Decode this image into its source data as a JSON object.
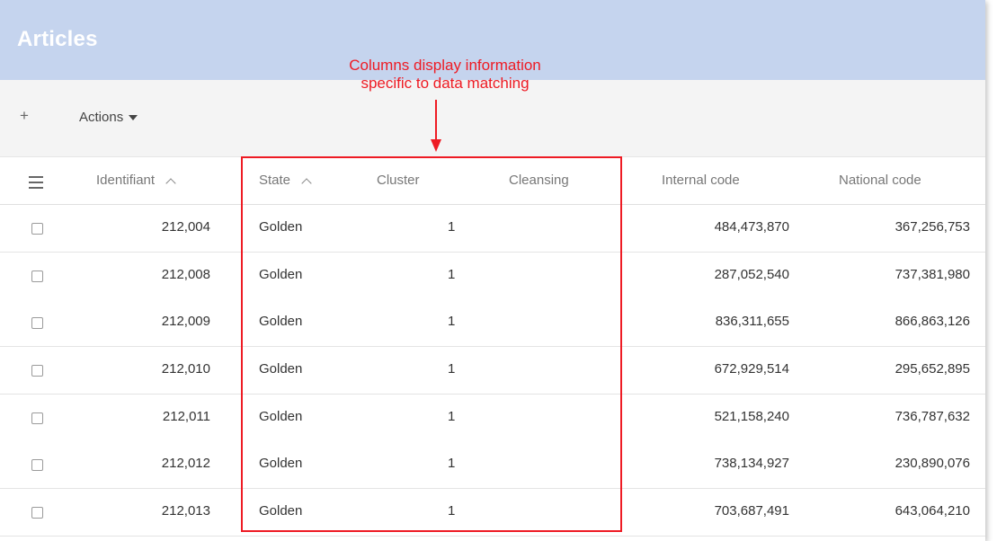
{
  "header": {
    "title": "Articles"
  },
  "toolbar": {
    "add_label": "+",
    "actions_label": "Actions"
  },
  "annotation": {
    "line1": "Columns display information",
    "line2": "specific to data matching"
  },
  "table": {
    "columns": {
      "identifiant": "Identifiant",
      "state": "State",
      "cluster": "Cluster",
      "cleansing": "Cleansing",
      "internal_code": "Internal code",
      "national_code": "National code"
    },
    "rows": [
      {
        "id": "212,004",
        "state": "Golden",
        "cluster": "1",
        "cleansing": "",
        "internal": "484,473,870",
        "national": "367,256,753"
      },
      {
        "id": "212,008",
        "state": "Golden",
        "cluster": "1",
        "cleansing": "",
        "internal": "287,052,540",
        "national": "737,381,980"
      },
      {
        "id": "212,009",
        "state": "Golden",
        "cluster": "1",
        "cleansing": "",
        "internal": "836,311,655",
        "national": "866,863,126"
      },
      {
        "id": "212,010",
        "state": "Golden",
        "cluster": "1",
        "cleansing": "",
        "internal": "672,929,514",
        "national": "295,652,895"
      },
      {
        "id": "212,011",
        "state": "Golden",
        "cluster": "1",
        "cleansing": "",
        "internal": "521,158,240",
        "national": "736,787,632"
      },
      {
        "id": "212,012",
        "state": "Golden",
        "cluster": "1",
        "cleansing": "",
        "internal": "738,134,927",
        "national": "230,890,076"
      },
      {
        "id": "212,013",
        "state": "Golden",
        "cluster": "1",
        "cleansing": "",
        "internal": "703,687,491",
        "national": "643,064,210"
      }
    ]
  },
  "colors": {
    "title_bar": "#c5d4ee",
    "accent_red": "#ee1b24",
    "toolbar_bg": "#f4f4f4"
  },
  "icons": {
    "menu": "hamburger-icon",
    "sort": "chevron-up-icon",
    "dropdown": "caret-down-icon",
    "add": "plus-icon"
  }
}
